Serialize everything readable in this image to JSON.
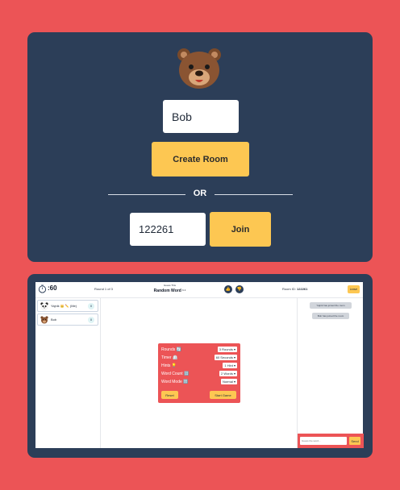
{
  "lobby": {
    "username_value": "Bob",
    "create_room_label": "Create Room",
    "or_label": "OR",
    "room_code_value": "122261",
    "join_label": "Join"
  },
  "game": {
    "timer": ":60",
    "round_text": "Round 1 of 3",
    "guess_label": "Guess This",
    "guess_word": "Random  Word",
    "word_length": "6 4",
    "room_id_label": "Room ID:",
    "room_id_value": "122261",
    "leave_label": "Leave",
    "players": [
      {
        "name": "Yajnik 👑 ✏️ (Me)",
        "score": "0",
        "avatar": "panda-icon"
      },
      {
        "name": "Bob",
        "score": "0",
        "avatar": "bear-icon"
      }
    ],
    "settings": [
      {
        "label": "Rounds 🔄",
        "value": "3 Rounds"
      },
      {
        "label": "Timer ⏲️",
        "value": "60 Seconds"
      },
      {
        "label": "Hints 💡",
        "value": "1 Hint"
      },
      {
        "label": "Word Count 🔢",
        "value": "2 Words"
      },
      {
        "label": "Word Mode 🔠",
        "value": "Normal"
      }
    ],
    "reset_label": "Reset",
    "start_label": "Start Game",
    "chat": [
      "Yajnik has joined the room",
      "Bob has joined the room"
    ],
    "chat_placeholder": "Guess the word...",
    "send_label": "Send"
  },
  "colors": {
    "background": "#ec5456",
    "card": "#2c3e58",
    "accent": "#fdc752"
  }
}
